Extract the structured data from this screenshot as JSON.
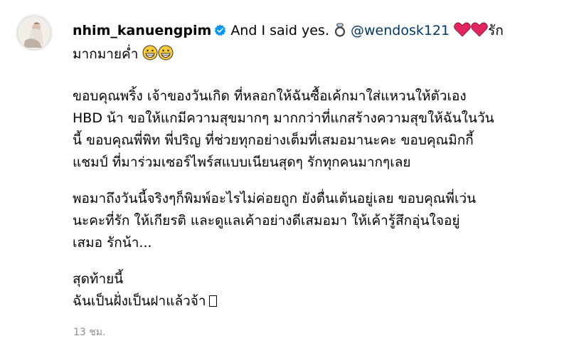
{
  "post": {
    "username": "nhim_kanuengpim",
    "verified": true,
    "caption_intro": "And I said yes.",
    "ring_emoji_icon": "ring-icon",
    "mention": "@wendosk121",
    "heart_icon": "red-heart-icon",
    "caption_end_line1": "รัก",
    "caption_line2": "มากมายค่ำ",
    "grin_icon": "grinning-face-icon",
    "paragraph1": [
      "ขอบคุณพริ้ง เจ้าของวันเกิด ที่หลอกให้ฉันซื้อเค้กมาใส่แหวนให้ตัวเอง",
      "HBD น้า ขอให้แกมีความสุขมากๆ มากกว่าที่แกสร้างความสุขให้ฉันในวัน",
      "นี้ ขอบคุณพี่พิท พี่ปริญ ที่ช่วยทุกอย่างเต็มที่เสมอมานะคะ ขอบคุณมิกกี้",
      "แชมป์ ที่มาร่วมเซอร์ไพร์สแบบเนียนสุดๆ รักทุกคนมากๆเลย"
    ],
    "paragraph2": [
      "พอมาถึงวันนี้จริงๆก็พิมพ์อะไรไม่ค่อยถูก ยังตื่นเต้นอยู่เลย ขอบคุณพี่เว่น",
      "นะคะที่รัก ให้เกียรติ และดูแลเค้าอย่างดีเสมอมา ให้เค้ารู้สึกอุ่นใจอยู่",
      "เสมอ รักน้า..."
    ],
    "paragraph3": [
      "สุดท้ายนี้",
      "ฉันเป็นฝั่งเป็นฝาแล้วจ้า"
    ],
    "timestamp": "13 ชม."
  },
  "colors": {
    "mention": "#00376b",
    "verified": "#0095f6",
    "heart": "#e0245e",
    "timestamp": "#8e8e8e"
  }
}
